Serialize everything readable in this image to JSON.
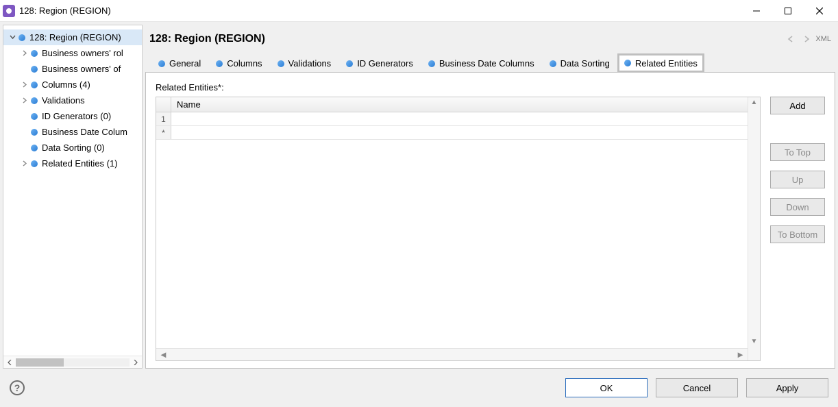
{
  "window": {
    "title": "128: Region (REGION)"
  },
  "tree": {
    "root": {
      "label": "128: Region (REGION)"
    },
    "items": [
      {
        "label": "Business owners' rol",
        "expandable": true
      },
      {
        "label": "Business owners' of",
        "expandable": false
      },
      {
        "label": "Columns (4)",
        "expandable": true
      },
      {
        "label": "Validations",
        "expandable": true
      },
      {
        "label": "ID Generators (0)",
        "expandable": false
      },
      {
        "label": "Business Date Colum",
        "expandable": false
      },
      {
        "label": "Data Sorting (0)",
        "expandable": false
      },
      {
        "label": "Related Entities (1)",
        "expandable": true
      }
    ]
  },
  "header": {
    "title": "128: Region (REGION)",
    "xml_label": "XML"
  },
  "tabs": [
    {
      "label": "General"
    },
    {
      "label": "Columns"
    },
    {
      "label": "Validations"
    },
    {
      "label": "ID Generators"
    },
    {
      "label": "Business Date Columns"
    },
    {
      "label": "Data Sorting"
    },
    {
      "label": "Related Entities"
    }
  ],
  "related": {
    "section_label": "Related Entities*:",
    "column_header": "Name",
    "rows": [
      {
        "num": "1",
        "name": ""
      },
      {
        "num": "*",
        "name": ""
      }
    ]
  },
  "side_buttons": {
    "add": "Add",
    "to_top": "To Top",
    "up": "Up",
    "down": "Down",
    "to_bottom": "To Bottom"
  },
  "footer": {
    "ok": "OK",
    "cancel": "Cancel",
    "apply": "Apply"
  }
}
